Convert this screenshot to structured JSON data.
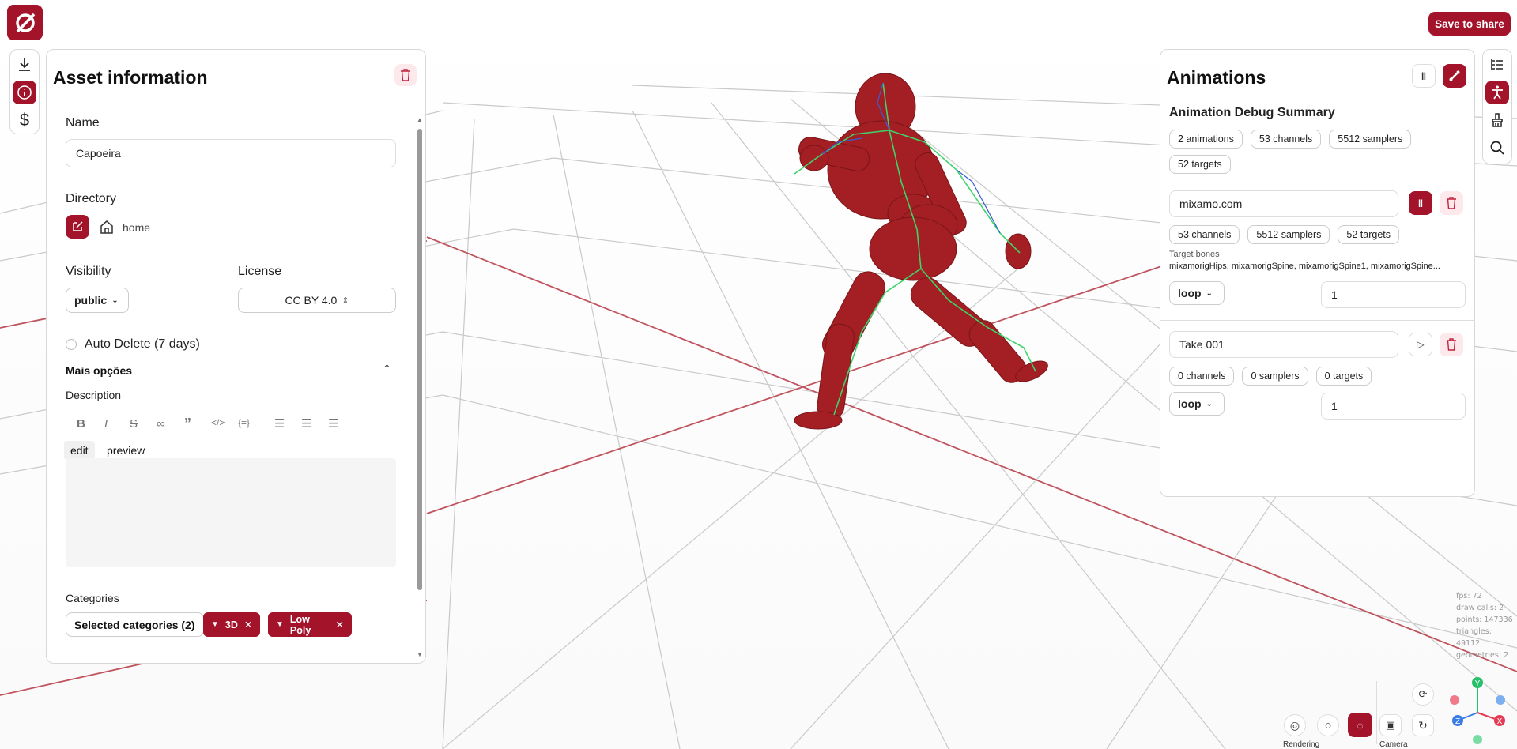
{
  "header": {
    "save_label": "Save to share"
  },
  "left_toolbar": {
    "icons": [
      "download-icon",
      "info-icon",
      "dollar-icon"
    ]
  },
  "right_toolbar": {
    "icons": [
      "outline-icon",
      "figure-icon",
      "brush-icon",
      "search-icon"
    ]
  },
  "asset_panel": {
    "title": "Asset information",
    "name_label": "Name",
    "name_value": "Capoeira",
    "directory_label": "Directory",
    "directory_value": "home",
    "visibility_label": "Visibility",
    "visibility_value": "public",
    "license_label": "License",
    "license_value": "CC BY 4.0",
    "auto_delete_label": "Auto Delete (7 days)",
    "more_options_label": "Mais opções",
    "description_label": "Description",
    "edit_tab": "edit",
    "preview_tab": "preview",
    "description_value": "",
    "categories_label": "Categories",
    "selected_categories": "Selected categories (2)",
    "category_tags": [
      "3D",
      "Low Poly"
    ]
  },
  "animations_panel": {
    "title": "Animations",
    "summary_title": "Animation Debug Summary",
    "summary_pills": [
      "2 animations",
      "53 channels",
      "5512 samplers",
      "52 targets"
    ],
    "clips": [
      {
        "name": "mixamo.com",
        "pills": [
          "53 channels",
          "5512 samplers",
          "52 targets"
        ],
        "target_bones_label": "Target bones",
        "target_bones": "mixamorigHips, mixamorigSpine, mixamorigSpine1, mixamorigSpine...",
        "loop": "loop",
        "repeat": "1"
      },
      {
        "name": "Take 001",
        "pills": [
          "0 channels",
          "0 samplers",
          "0 targets"
        ],
        "loop": "loop",
        "repeat": "1"
      }
    ]
  },
  "stats": {
    "fps": "fps: 72",
    "draw_calls": "draw calls: 2",
    "points": "points: 147336",
    "triangles": "triangles: 49112",
    "geometries": "geometries: 2"
  },
  "bottom_controls": {
    "rendering_label": "Rendering",
    "camera_label": "Camera"
  },
  "gizmo": {
    "y": "Y",
    "x": "X",
    "z": "Z"
  },
  "colors": {
    "accent": "#a3132a",
    "grid_major": "#c0545e",
    "grid_minor": "#c4c4c4",
    "model": "#a31f24"
  }
}
